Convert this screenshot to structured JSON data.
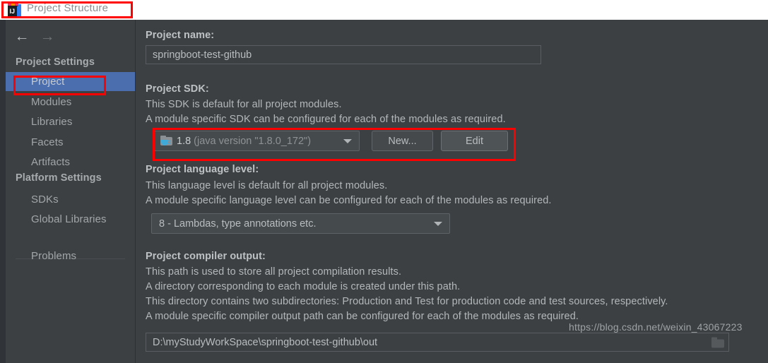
{
  "window": {
    "title": "Project Structure",
    "app_icon": "intellij-idea-icon"
  },
  "nav": {
    "back_icon": "←",
    "forward_icon": "→"
  },
  "sidebar": {
    "sections": [
      {
        "label": "Project Settings"
      },
      {
        "label": "Platform Settings"
      }
    ],
    "items": [
      {
        "label": "Project",
        "selected": true
      },
      {
        "label": "Modules",
        "selected": false
      },
      {
        "label": "Libraries",
        "selected": false
      },
      {
        "label": "Facets",
        "selected": false
      },
      {
        "label": "Artifacts",
        "selected": false
      },
      {
        "label": "SDKs",
        "selected": false
      },
      {
        "label": "Global Libraries",
        "selected": false
      },
      {
        "label": "Problems",
        "selected": false
      }
    ]
  },
  "main": {
    "project_name": {
      "label": "Project name:",
      "value": "springboot-test-github"
    },
    "project_sdk": {
      "label": "Project SDK:",
      "desc_line1": "This SDK is default for all project modules.",
      "desc_line2": "A module specific SDK can be configured for each of the modules as required.",
      "sdk_version": "1.8",
      "sdk_detail": "(java version \"1.8.0_172\")",
      "sdk_icon": "java-sdk-folder-icon",
      "new_button": "New...",
      "edit_button": "Edit"
    },
    "language_level": {
      "label": "Project language level:",
      "desc_line1": "This language level is default for all project modules.",
      "desc_line2": "A module specific language level can be configured for each of the modules as required.",
      "value": "8 - Lambdas, type annotations etc."
    },
    "compiler_output": {
      "label": "Project compiler output:",
      "desc_line1": "This path is used to store all project compilation results.",
      "desc_line2": "A directory corresponding to each module is created under this path.",
      "desc_line3": "This directory contains two subdirectories: Production and Test for production code and test sources, respectively.",
      "desc_line4": "A module specific compiler output path can be configured for each of the modules as required.",
      "value": "D:\\myStudyWorkSpace\\springboot-test-github\\out",
      "browse_icon": "folder-browse-icon"
    }
  },
  "watermark": {
    "text": "https://blog.csdn.net/weixin_43067223"
  },
  "colors": {
    "background": "#3c4043",
    "selection": "#4b6eaf",
    "annotation": "#ff0000",
    "title_bar": "#ffffff"
  }
}
